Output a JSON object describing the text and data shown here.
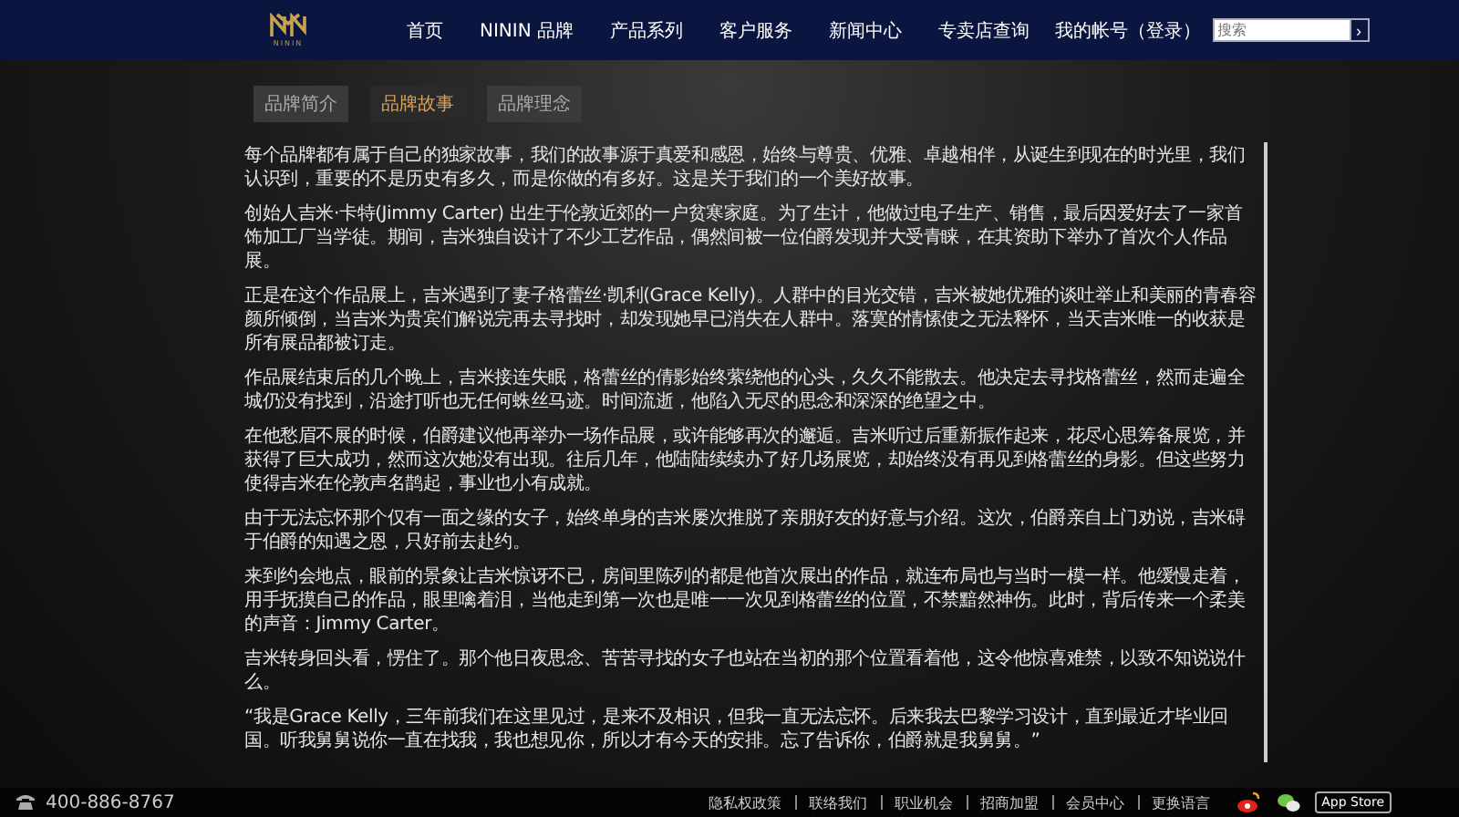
{
  "header": {
    "logo_text": "NININ",
    "nav": [
      {
        "label": "首页"
      },
      {
        "label": "NININ 品牌"
      },
      {
        "label": "产品系列"
      },
      {
        "label": "客户服务"
      },
      {
        "label": "新闻中心"
      },
      {
        "label": "专卖店查询"
      }
    ],
    "account": "我的帐号（登录）",
    "search": {
      "placeholder": "搜索",
      "button": "›"
    }
  },
  "tabs": [
    {
      "label": "品牌简介",
      "selected": false
    },
    {
      "label": "品牌故事",
      "selected": true
    },
    {
      "label": "品牌理念",
      "selected": false
    }
  ],
  "paragraphs": [
    "每个品牌都有属于自己的独家故事，我们的故事源于真爱和感恩，始终与尊贵、优雅、卓越相伴，从诞生到现在的时光里，我们认识到，重要的不是历史有多久，而是你做的有多好。这是关于我们的一个美好故事。",
    "创始人吉米·卡特(Jimmy Carter) 出生于伦敦近郊的一户贫寒家庭。为了生计，他做过电子生产、销售，最后因爱好去了一家首饰加工厂当学徒。期间，吉米独自设计了不少工艺作品，偶然间被一位伯爵发现并大受青睐，在其资助下举办了首次个人作品展。",
    "正是在这个作品展上，吉米遇到了妻子格蕾丝·凯利(Grace Kelly)。人群中的目光交错，吉米被她优雅的谈吐举止和美丽的青春容颜所倾倒，当吉米为贵宾们解说完再去寻找时，却发现她早已消失在人群中。落寞的情愫使之无法释怀，当天吉米唯一的收获是所有展品都被订走。",
    "作品展结束后的几个晚上，吉米接连失眠，格蕾丝的倩影始终萦绕他的心头，久久不能散去。他决定去寻找格蕾丝，然而走遍全城仍没有找到，沿途打听也无任何蛛丝马迹。时间流逝，他陷入无尽的思念和深深的绝望之中。",
    "在他愁眉不展的时候，伯爵建议他再举办一场作品展，或许能够再次的邂逅。吉米听过后重新振作起来，花尽心思筹备展览，并获得了巨大成功，然而这次她没有出现。往后几年，他陆陆续续办了好几场展览，却始终没有再见到格蕾丝的身影。但这些努力使得吉米在伦敦声名鹊起，事业也小有成就。",
    "由于无法忘怀那个仅有一面之缘的女子，始终单身的吉米屡次推脱了亲朋好友的好意与介绍。这次，伯爵亲自上门劝说，吉米碍于伯爵的知遇之恩，只好前去赴约。",
    "来到约会地点，眼前的景象让吉米惊讶不已，房间里陈列的都是他首次展出的作品，就连布局也与当时一模一样。他缓慢走着，用手抚摸自己的作品，眼里噙着泪，当他走到第一次也是唯一一次见到格蕾丝的位置，不禁黯然神伤。此时，背后传来一个柔美的声音：Jimmy Carter。",
    "吉米转身回头看，愣住了。那个他日夜思念、苦苦寻找的女子也站在当初的那个位置看着他，这令他惊喜难禁，以致不知说说什么。",
    "“我是Grace Kelly，三年前我们在这里见过，是来不及相识，但我一直无法忘怀。后来我去巴黎学习设计，直到最近才毕业回国。听我舅舅说你一直在找我，我也想见你，所以才有今天的安排。忘了告诉你，伯爵就是我舅舅。”"
  ],
  "footer": {
    "phone": "400-886-8767",
    "links": [
      {
        "label": "隐私权政策"
      },
      {
        "label": "联络我们"
      },
      {
        "label": "职业机会"
      },
      {
        "label": "招商加盟"
      },
      {
        "label": "会员中心"
      },
      {
        "label": "更换语言"
      }
    ],
    "app_store": "App Store"
  }
}
